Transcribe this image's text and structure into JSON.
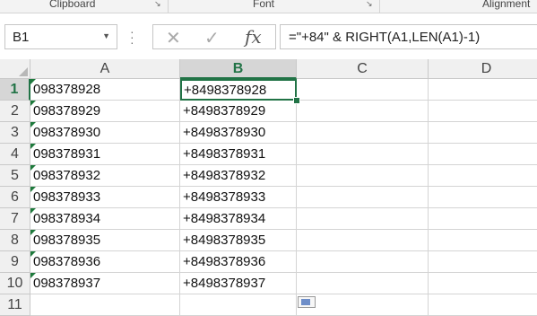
{
  "ribbon": {
    "groups": [
      {
        "label": "Clipboard"
      },
      {
        "label": "Font"
      },
      {
        "label": "Alignment"
      }
    ],
    "launcher_glyph": "↘"
  },
  "formula_bar": {
    "name_box": "B1",
    "cancel_glyph": "✕",
    "enter_glyph": "✓",
    "fx_label": "fx",
    "formula": "=\"+84\" & RIGHT(A1,LEN(A1)-1)"
  },
  "sheet": {
    "columns": [
      "A",
      "B",
      "C",
      "D"
    ],
    "selected_column": "B",
    "selected_row": "1",
    "rows": [
      {
        "num": "1",
        "a": "098378928",
        "b": "+8498378928"
      },
      {
        "num": "2",
        "a": "098378929",
        "b": "+8498378929"
      },
      {
        "num": "3",
        "a": "098378930",
        "b": "+8498378930"
      },
      {
        "num": "4",
        "a": "098378931",
        "b": "+8498378931"
      },
      {
        "num": "5",
        "a": "098378932",
        "b": "+8498378932"
      },
      {
        "num": "6",
        "a": "098378933",
        "b": "+8498378933"
      },
      {
        "num": "7",
        "a": "098378934",
        "b": "+8498378934"
      },
      {
        "num": "8",
        "a": "098378935",
        "b": "+8498378935"
      },
      {
        "num": "9",
        "a": "098378936",
        "b": "+8498378936"
      },
      {
        "num": "10",
        "a": "098378937",
        "b": "+8498378937"
      },
      {
        "num": "11",
        "a": "",
        "b": ""
      }
    ]
  },
  "colors": {
    "accent": "#217346",
    "error_flag": "#1e7a3c"
  }
}
